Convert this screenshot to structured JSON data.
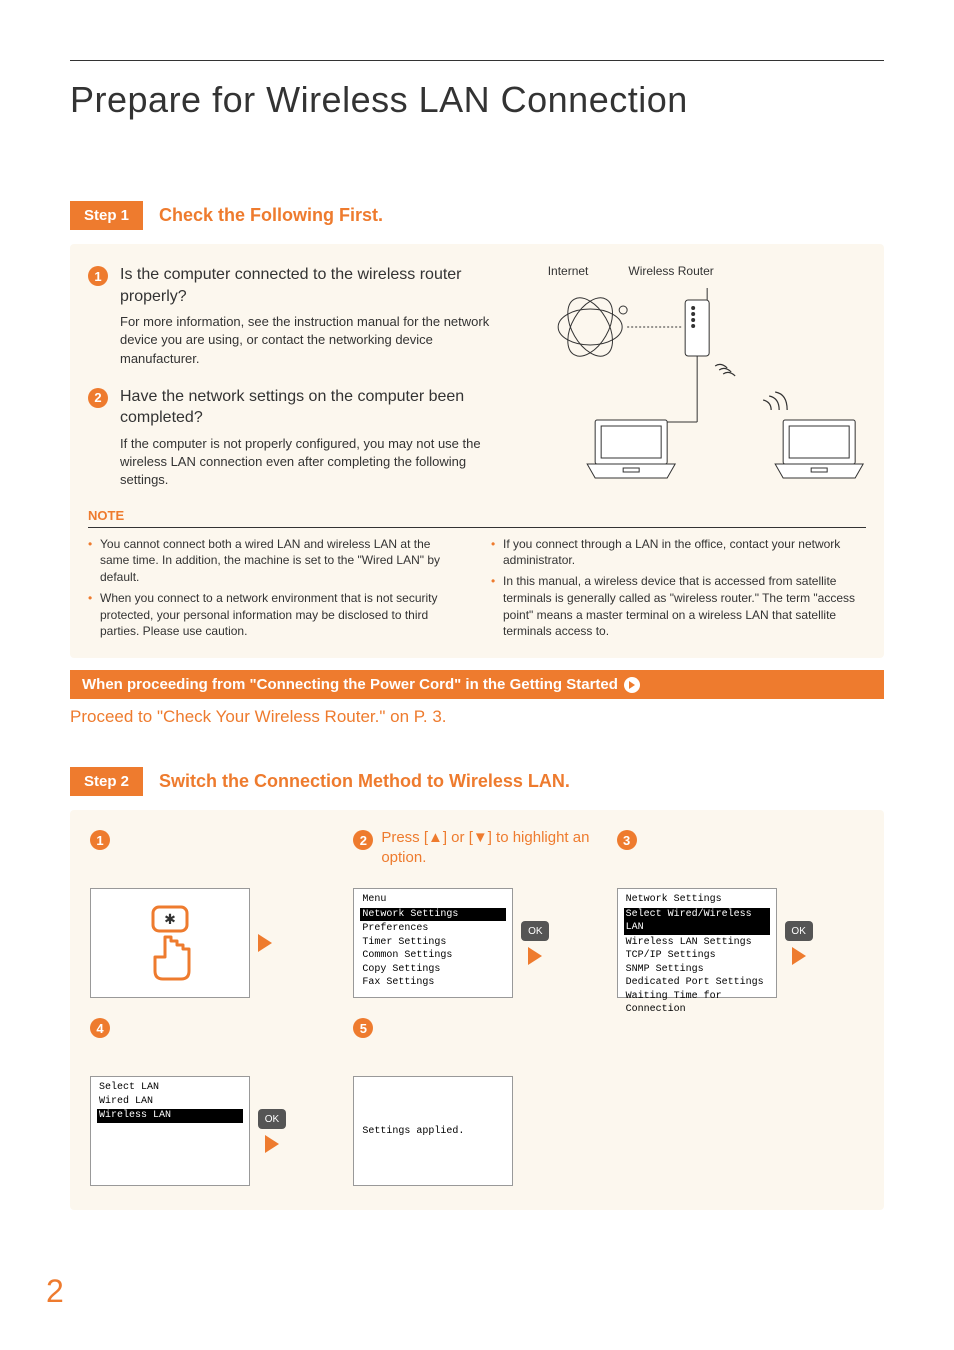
{
  "pageTitle": "Prepare for Wireless LAN Connection",
  "pageNumber": "2",
  "step1": {
    "badge": "Step 1",
    "title": "Check the Following First.",
    "checks": [
      {
        "q": "Is the computer connected to the wireless router properly?",
        "a": "For more information, see the instruction manual for the network device you are using, or contact the networking device manufacturer."
      },
      {
        "q": "Have the network settings on the computer been completed?",
        "a": "If the computer is not properly configured, you may not use the wireless LAN connection even after completing the following settings."
      }
    ],
    "diagramLabels": {
      "internet": "Internet",
      "router": "Wireless Router"
    },
    "noteLabel": "NOTE",
    "notesLeft": [
      "You cannot connect both a wired LAN and wireless LAN at the same time. In addition, the machine is set to the \"Wired LAN\" by default.",
      "When you connect to a network environment that is not security protected, your personal information may be disclosed to third parties. Please use caution."
    ],
    "notesRight": [
      "If you connect through a LAN in the office, contact your network administrator.",
      "In this manual, a wireless device that is accessed from satellite terminals is generally called as \"wireless router.\" The term \"access point\" means a master terminal on a wireless LAN that satellite terminals access to."
    ]
  },
  "forwardBar": "When proceeding from \"Connecting the Power Cord\" in the Getting Started",
  "forwardText": "Proceed to \"Check Your Wireless Router.\" on P. 3.",
  "step2": {
    "badge": "Step 2",
    "title": "Switch the Connection Method to Wireless LAN.",
    "substep2Text": "Press [▲] or [▼] to highlight an option.",
    "okLabel": "OK",
    "menuScreen": {
      "line1": "Menu",
      "highlight": "Network Settings",
      "lines": [
        "Preferences",
        "Timer Settings",
        "Common Settings",
        "Copy Settings",
        "Fax Settings"
      ]
    },
    "netScreen": {
      "line1": "Network Settings",
      "highlight": "Select Wired/Wireless LAN",
      "lines": [
        "Wireless LAN Settings",
        "TCP/IP Settings",
        "SNMP Settings",
        "Dedicated Port Settings",
        "Waiting Time for Connection"
      ]
    },
    "selectScreen": {
      "line1": "Select LAN",
      "line2": "Wired LAN",
      "highlight": "Wireless LAN"
    },
    "appliedScreen": {
      "text": "Settings applied."
    }
  }
}
